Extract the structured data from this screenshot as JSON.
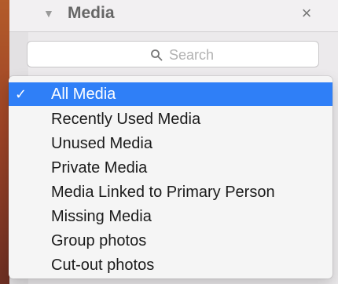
{
  "panel": {
    "title": "Media",
    "close_glyph": "×",
    "disclosure_glyph": "▼",
    "search_placeholder": "Search"
  },
  "menu": {
    "selected_index": 0,
    "check_glyph": "✓",
    "items": [
      {
        "label": "All Media",
        "selected": true
      },
      {
        "label": "Recently Used Media",
        "selected": false
      },
      {
        "label": "Unused Media",
        "selected": false
      },
      {
        "label": "Private Media",
        "selected": false
      },
      {
        "label": "Media Linked to Primary Person",
        "selected": false
      },
      {
        "label": "Missing Media",
        "selected": false
      },
      {
        "label": "Group photos",
        "selected": false
      },
      {
        "label": "Cut-out photos",
        "selected": false
      }
    ]
  },
  "colors": {
    "accent": "#2f7ff7",
    "panel_bg": "#eceaec",
    "dropdown_bg": "#f5f5f5",
    "text": "#1b1b1b"
  }
}
